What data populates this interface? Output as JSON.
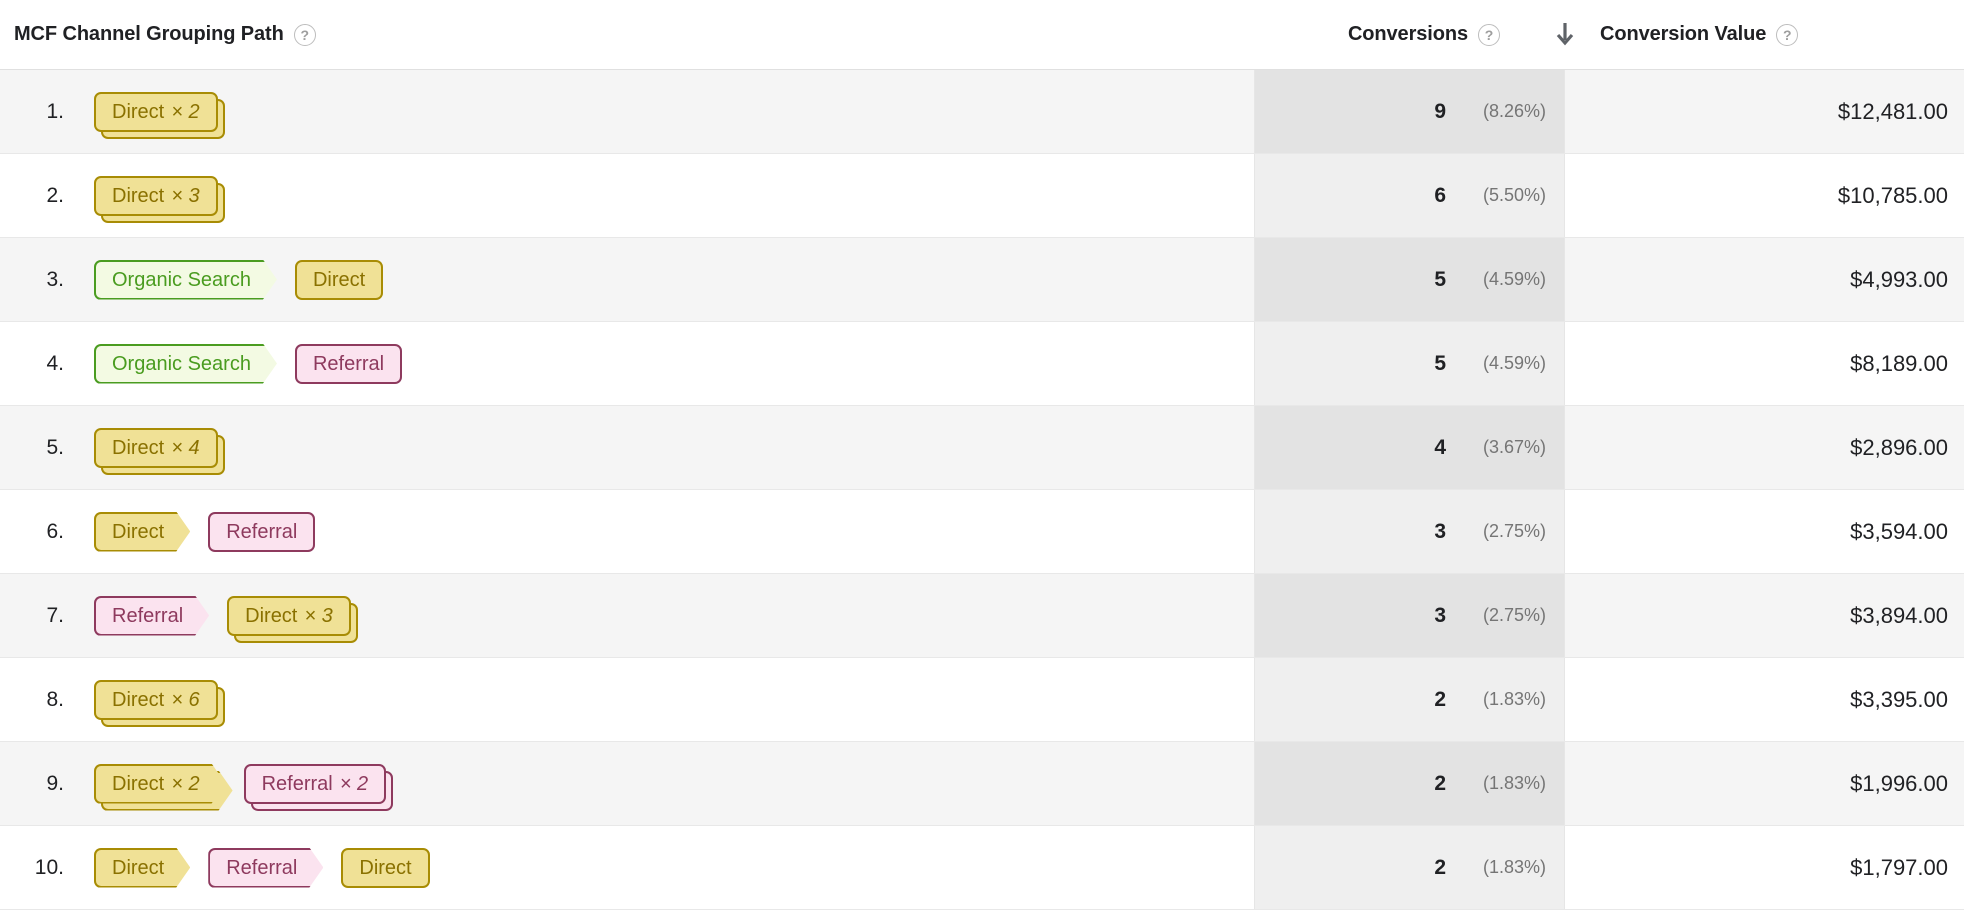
{
  "header": {
    "path_column_label": "MCF Channel Grouping Path",
    "conversions_label": "Conversions",
    "conversion_value_label": "Conversion Value",
    "help_glyph": "?",
    "sort_direction": "descending",
    "sort_arrow_glyph": "↓"
  },
  "colors": {
    "direct_bg": "#f0e196",
    "direct_border": "#a88c04",
    "direct_text": "#8a7100",
    "organic_bg": "#f3fae3",
    "organic_border": "#4a9c20",
    "organic_text": "#4a9c20",
    "referral_bg": "#fbe3ef",
    "referral_border": "#8e3a5e",
    "referral_text": "#8e3a5e",
    "row_odd_bg": "#f5f5f5",
    "row_even_bg": "#ffffff",
    "conv_col_odd_bg": "#e3e3e3",
    "conv_col_even_bg": "#efefef"
  },
  "rows": [
    {
      "index": "1.",
      "path": [
        {
          "channel": "Direct",
          "label": "Direct",
          "multiplier": "× 2",
          "count": 2,
          "terminal": true
        }
      ],
      "conversions": "9",
      "conversions_pct": "(8.26%)",
      "conversion_value": "$12,481.00"
    },
    {
      "index": "2.",
      "path": [
        {
          "channel": "Direct",
          "label": "Direct",
          "multiplier": "× 3",
          "count": 3,
          "terminal": true
        }
      ],
      "conversions": "6",
      "conversions_pct": "(5.50%)",
      "conversion_value": "$10,785.00"
    },
    {
      "index": "3.",
      "path": [
        {
          "channel": "Organic Search",
          "label": "Organic Search",
          "multiplier": "",
          "count": 1,
          "terminal": false
        },
        {
          "channel": "Direct",
          "label": "Direct",
          "multiplier": "",
          "count": 1,
          "terminal": true
        }
      ],
      "conversions": "5",
      "conversions_pct": "(4.59%)",
      "conversion_value": "$4,993.00"
    },
    {
      "index": "4.",
      "path": [
        {
          "channel": "Organic Search",
          "label": "Organic Search",
          "multiplier": "",
          "count": 1,
          "terminal": false
        },
        {
          "channel": "Referral",
          "label": "Referral",
          "multiplier": "",
          "count": 1,
          "terminal": true
        }
      ],
      "conversions": "5",
      "conversions_pct": "(4.59%)",
      "conversion_value": "$8,189.00"
    },
    {
      "index": "5.",
      "path": [
        {
          "channel": "Direct",
          "label": "Direct",
          "multiplier": "× 4",
          "count": 4,
          "terminal": true
        }
      ],
      "conversions": "4",
      "conversions_pct": "(3.67%)",
      "conversion_value": "$2,896.00"
    },
    {
      "index": "6.",
      "path": [
        {
          "channel": "Direct",
          "label": "Direct",
          "multiplier": "",
          "count": 1,
          "terminal": false
        },
        {
          "channel": "Referral",
          "label": "Referral",
          "multiplier": "",
          "count": 1,
          "terminal": true
        }
      ],
      "conversions": "3",
      "conversions_pct": "(2.75%)",
      "conversion_value": "$3,594.00"
    },
    {
      "index": "7.",
      "path": [
        {
          "channel": "Referral",
          "label": "Referral",
          "multiplier": "",
          "count": 1,
          "terminal": false
        },
        {
          "channel": "Direct",
          "label": "Direct",
          "multiplier": "× 3",
          "count": 3,
          "terminal": true
        }
      ],
      "conversions": "3",
      "conversions_pct": "(2.75%)",
      "conversion_value": "$3,894.00"
    },
    {
      "index": "8.",
      "path": [
        {
          "channel": "Direct",
          "label": "Direct",
          "multiplier": "× 6",
          "count": 6,
          "terminal": true
        }
      ],
      "conversions": "2",
      "conversions_pct": "(1.83%)",
      "conversion_value": "$3,395.00"
    },
    {
      "index": "9.",
      "path": [
        {
          "channel": "Direct",
          "label": "Direct",
          "multiplier": "× 2",
          "count": 2,
          "terminal": false
        },
        {
          "channel": "Referral",
          "label": "Referral",
          "multiplier": "× 2",
          "count": 2,
          "terminal": true
        }
      ],
      "conversions": "2",
      "conversions_pct": "(1.83%)",
      "conversion_value": "$1,996.00"
    },
    {
      "index": "10.",
      "path": [
        {
          "channel": "Direct",
          "label": "Direct",
          "multiplier": "",
          "count": 1,
          "terminal": false
        },
        {
          "channel": "Referral",
          "label": "Referral",
          "multiplier": "",
          "count": 1,
          "terminal": false
        },
        {
          "channel": "Direct",
          "label": "Direct",
          "multiplier": "",
          "count": 1,
          "terminal": true
        }
      ],
      "conversions": "2",
      "conversions_pct": "(1.83%)",
      "conversion_value": "$1,797.00"
    }
  ]
}
